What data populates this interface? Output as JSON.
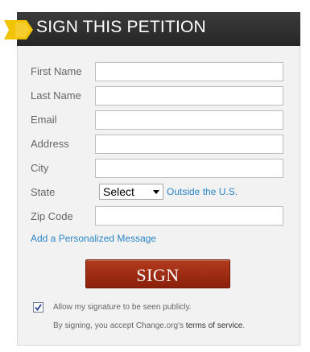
{
  "header": {
    "title": "SIGN THIS PETITION"
  },
  "form": {
    "fields": [
      {
        "label": "First Name",
        "value": ""
      },
      {
        "label": "Last Name",
        "value": ""
      },
      {
        "label": "Email",
        "value": ""
      },
      {
        "label": "Address",
        "value": ""
      },
      {
        "label": "City",
        "value": ""
      }
    ],
    "state": {
      "label": "State",
      "selected": "Select",
      "outside_link": "Outside the U.S."
    },
    "zip": {
      "label": "Zip Code",
      "value": ""
    },
    "personal_message_link": "Add a Personalized Message",
    "sign_label": "SIGN",
    "public_checkbox": {
      "checked": true,
      "label": "Allow my signature to be seen publicly."
    },
    "terms": {
      "prefix": "By signing, you accept Change.org's ",
      "link": "terms of service",
      "suffix": "."
    }
  },
  "colors": {
    "header_bg": "#2e2e2e",
    "flag": "#f2c300",
    "sign_button": "#9e2a12",
    "link": "#2a86c8"
  },
  "icons": {
    "flag": "flag-ribbon-icon",
    "select_arrow": "chevron-down-icon",
    "checkbox": "checkmark-icon"
  }
}
